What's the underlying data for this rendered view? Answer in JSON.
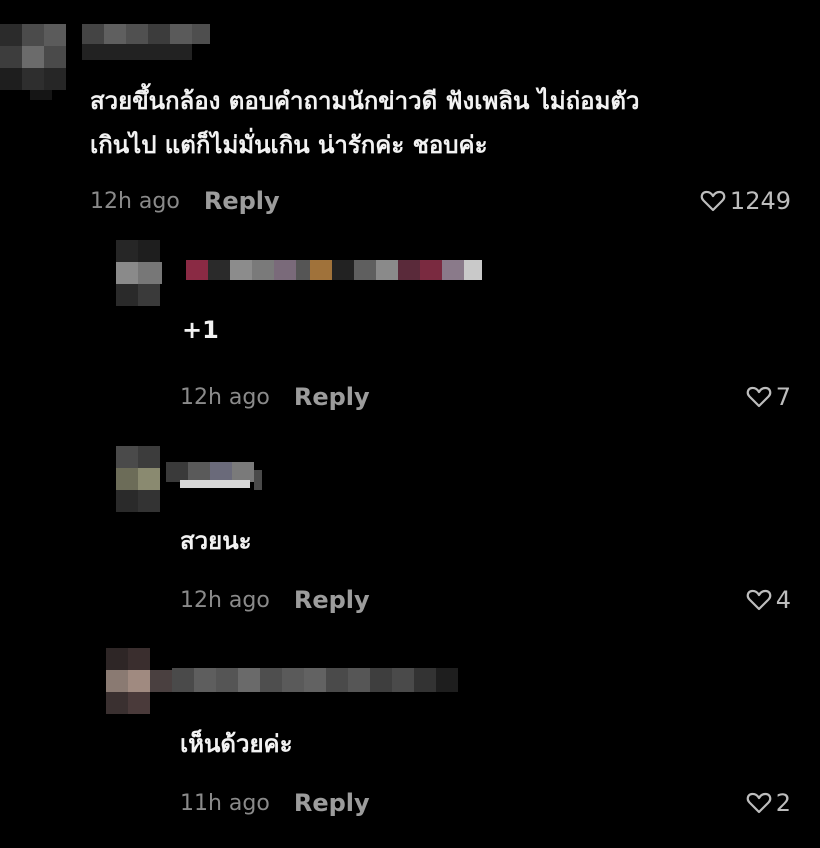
{
  "comment": {
    "text_line1": "สวยขึ้นกล้อง ตอบคำถามนักข่าวดี ฟังเพลิน ไม่ถ่อมตัว",
    "text_line2": "เกินไป แต่ก็ไม่มั่นเกิน น่ารักค่ะ ชอบค่ะ",
    "time": "12h ago",
    "reply_label": "Reply",
    "likes": "1249",
    "icon": "heart-outline-icon"
  },
  "replies": [
    {
      "text": "+1",
      "time": "12h ago",
      "reply_label": "Reply",
      "likes": "7"
    },
    {
      "text": "สวยนะ",
      "time": "12h ago",
      "reply_label": "Reply",
      "likes": "4"
    },
    {
      "text": "เห็นด้วยค่ะ",
      "time": "11h ago",
      "reply_label": "Reply",
      "likes": "2"
    }
  ],
  "colors": {
    "background": "#000000",
    "text": "#f2f2f2",
    "secondary": "#8a8a8a"
  }
}
